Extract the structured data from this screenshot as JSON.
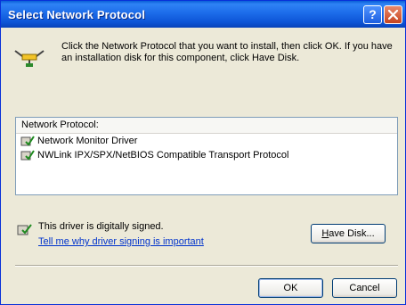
{
  "window": {
    "title": "Select Network Protocol"
  },
  "instruction": "Click the Network Protocol that you want to install, then click OK. If you have an installation disk for this component, click Have Disk.",
  "protocol_list": {
    "header": "Network Protocol:",
    "items": [
      {
        "label": "Network Monitor Driver"
      },
      {
        "label": "NWLink IPX/SPX/NetBIOS Compatible Transport Protocol"
      }
    ]
  },
  "signing": {
    "status_text": "This driver is digitally signed.",
    "link_text": "Tell me why driver signing is important"
  },
  "buttons": {
    "have_disk": {
      "mnemonic": "H",
      "rest": "ave Disk..."
    },
    "ok": "OK",
    "cancel": "Cancel"
  },
  "icons": {
    "title_help": "help-icon",
    "title_close": "close-icon",
    "network": "network-protocol-icon",
    "protocol": "protocol-item-icon",
    "signed": "signed-driver-icon"
  },
  "colors": {
    "titlebar": "#0d54d6",
    "dialog_bg": "#ece9d8",
    "link": "#0033cc",
    "close_button": "#c6441f"
  }
}
